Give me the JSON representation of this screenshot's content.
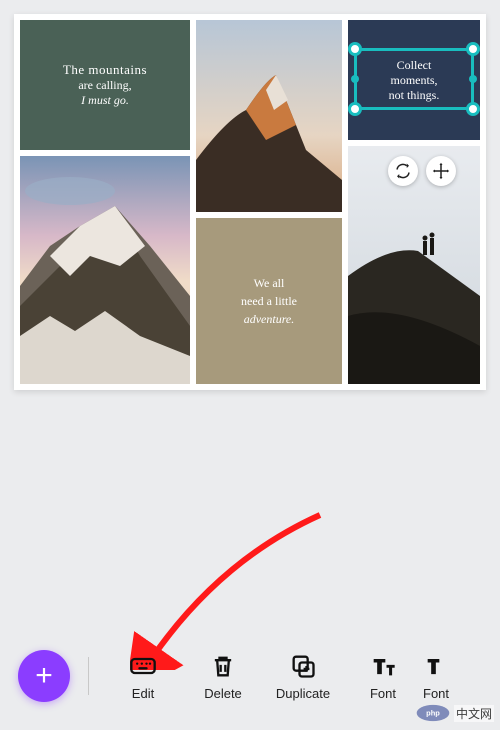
{
  "panels": {
    "green": {
      "line1": "The mountains",
      "line2": "are calling,",
      "line3": "I must go."
    },
    "navy": {
      "line1": "Collect",
      "line2": "moments,",
      "line3": "not things."
    },
    "taupe": {
      "line1": "We all",
      "line2": "need a little",
      "line3": "adventure."
    }
  },
  "floating": {
    "rotate": "↻↺",
    "move": "✥"
  },
  "toolbar": {
    "add": "+",
    "edit": "Edit",
    "delete": "Delete",
    "duplicate": "Duplicate",
    "font": "Font",
    "font2": "Font"
  },
  "watermark": {
    "brand": "php",
    "text": "中文网"
  },
  "colors": {
    "green": "#4a6156",
    "navy": "#2b3a55",
    "taupe": "#a79a7c",
    "selection": "#19bdbf",
    "fab": "#8b3dff",
    "arrow": "#ff1a1a"
  }
}
